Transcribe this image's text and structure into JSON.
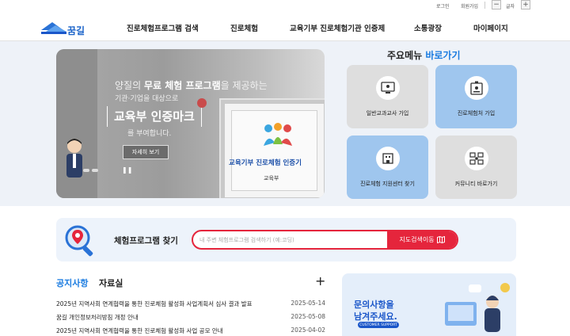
{
  "utility": {
    "login": "로그인",
    "join": "회원가입",
    "font_minus": "−",
    "font_label": "글자",
    "font_plus": "+"
  },
  "logo": {
    "name": "꿈길"
  },
  "nav": [
    {
      "label": "진로체험프로그램 검색"
    },
    {
      "label": "진로체험"
    },
    {
      "label": "교육기부 진로체험기관 인증제"
    },
    {
      "label": "소통광장"
    },
    {
      "label": "마이페이지"
    }
  ],
  "hero": {
    "line1_pre": "양질의 ",
    "line1_bold": "무료 체험 프로그램",
    "line1_post": "을 제공하는",
    "line2": "기관·기업을 대상으로",
    "line3": "교육부 인증마크",
    "line4": "를 부여합니다.",
    "button": "자세히 보기",
    "pause": "❚❚",
    "cert_title": "교육기부 진로체험 인증기",
    "cert_moe": "교육부"
  },
  "quick_menu": {
    "title_pre": "주요메뉴 ",
    "title_accent": "바로가기",
    "items": [
      {
        "label": "일반교과교사 가입"
      },
      {
        "label": "진로체험처 가입"
      },
      {
        "label": "진로체험 지원센터 찾기"
      },
      {
        "label": "커뮤니티 바로가기"
      }
    ]
  },
  "search": {
    "title": "체험프로그램 찾기",
    "placeholder": "내 주변 체험프로그램 검색하기 (예:코딩)",
    "map_button": "지도검색이동"
  },
  "notice": {
    "tab_notice": "공지사항",
    "tab_data": "자료실",
    "more": "+",
    "rows": [
      {
        "title": "2025년 지역사회 연계협력을 통한 진로체험 활성화 사업계획서 심사 결과 발표",
        "date": "2025-05-14"
      },
      {
        "title": "꿈길 개인정보처리방침 개정 안내",
        "date": "2025-05-08"
      },
      {
        "title": "2025년 지역사회 연계협력을 통한 진로체험 활성화 사업 공모 안내",
        "date": "2025-04-02"
      }
    ]
  },
  "support": {
    "line1": "문의사항을",
    "line2": "남겨주세요.",
    "tag": "CUSTOMER SUPPORT"
  }
}
